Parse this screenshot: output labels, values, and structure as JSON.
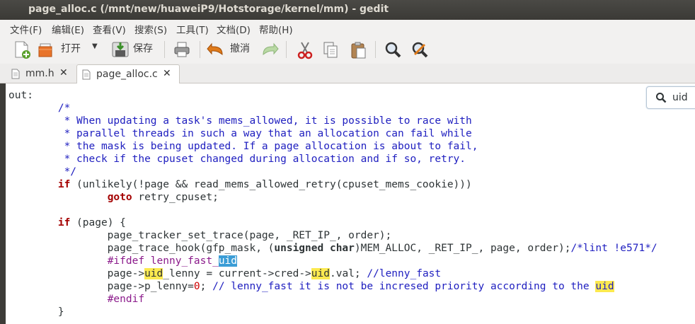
{
  "window": {
    "title": "page_alloc.c (/mnt/new/huaweiP9/Hotstorage/kernel/mm) - gedit"
  },
  "menu": [
    "文件(F)",
    "编辑(E)",
    "查看(V)",
    "搜索(S)",
    "工具(T)",
    "文档(D)",
    "帮助(H)"
  ],
  "toolbar": {
    "open_label": "打开",
    "save_label": "保存",
    "undo_label": "撤消"
  },
  "tabs": [
    {
      "label": "mm.h",
      "active": false
    },
    {
      "label": "page_alloc.c",
      "active": true
    }
  ],
  "search": {
    "value": "uid"
  },
  "code_lines": [
    "out:",
    "\t/*",
    "\t * When updating a task's mems_allowed, it is possible to race with",
    "\t * parallel threads in such a way that an allocation can fail while",
    "\t * the mask is being updated. If a page allocation is about to fail,",
    "\t * check if the cpuset changed during allocation and if so, retry.",
    "\t */",
    "\tif (unlikely(!page && read_mems_allowed_retry(cpuset_mems_cookie)))",
    "\t\tgoto retry_cpuset;",
    "",
    "\tif (page) {",
    "\t\tpage_tracker_set_trace(page, _RET_IP_, order);",
    "\t\tpage_trace_hook(gfp_mask, (unsigned char)MEM_ALLOC, _RET_IP_, page, order);/*lint !e571*/",
    "\t\t#ifdef lenny_fast_uid",
    "\t\tpage->uid_lenny = current->cred->uid.val; //lenny_fast",
    "\t\tpage->p_lenny=0; // lenny_fast it is not be incresed priority according to the uid",
    "\t\t#endif",
    "\t}"
  ]
}
